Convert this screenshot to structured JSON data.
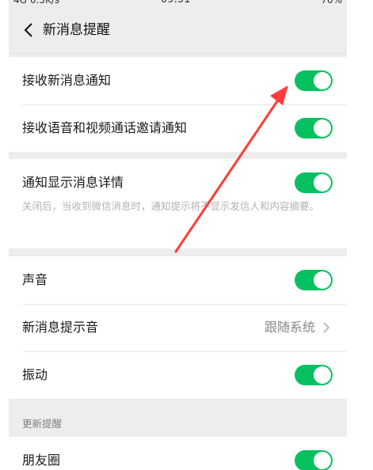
{
  "statusbar": {
    "left": "4G",
    "speed": "0.5K/s",
    "time": "09:51",
    "battery": "70%"
  },
  "header": {
    "title": "新消息提醒"
  },
  "groups": {
    "g1": [
      {
        "label": "接收新消息通知",
        "toggle": true
      },
      {
        "label": "接收语音和视频通话邀请通知",
        "toggle": true
      }
    ],
    "g2": {
      "label": "通知显示消息详情",
      "toggle": true,
      "desc": "关闭后，当收到微信消息时，通知提示将不显示发信人和内容摘要。"
    },
    "g3": [
      {
        "label": "声音",
        "toggle": true
      },
      {
        "label": "新消息提示音",
        "value": "跟随系统"
      },
      {
        "label": "振动",
        "toggle": true
      }
    ]
  },
  "section": {
    "header": "更新提醒",
    "item": {
      "label": "朋友圈",
      "toggle": true
    }
  },
  "colors": {
    "toggle_on": "#07c160",
    "annotation_arrow": "#ff3b3b"
  },
  "icons": [
    "back-chevron-icon",
    "chevron-right-icon",
    "annotation-arrow"
  ]
}
